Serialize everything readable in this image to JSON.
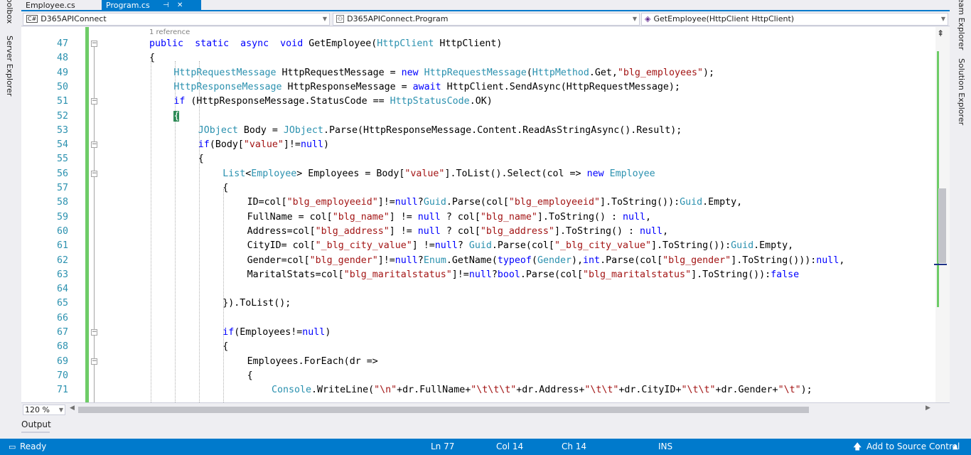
{
  "tabs": [
    {
      "label": "Employee.cs",
      "active": false
    },
    {
      "label": "Program.cs",
      "active": true
    }
  ],
  "nav": {
    "project": "D365APIConnect",
    "type": "D365APIConnect.Program",
    "member": "GetEmployee(HttpClient HttpClient)"
  },
  "left_tool_windows": [
    "Toolbox",
    "Server Explorer"
  ],
  "right_tool_windows": [
    "Team Explorer",
    "Solution Explorer"
  ],
  "codelens": "1 reference",
  "lines": [
    {
      "n": "47",
      "indent": 0,
      "tokens": [
        [
          "k",
          "public"
        ],
        [
          "",
          "  "
        ],
        [
          "k",
          "static"
        ],
        [
          "",
          "  "
        ],
        [
          "k",
          "async"
        ],
        [
          "",
          "  "
        ],
        [
          "k",
          "void"
        ],
        [
          "",
          " GetEmployee("
        ],
        [
          "t",
          "HttpClient"
        ],
        [
          "",
          " HttpClient)"
        ]
      ]
    },
    {
      "n": "48",
      "indent": 0,
      "tokens": [
        [
          "",
          "{"
        ]
      ]
    },
    {
      "n": "49",
      "indent": 1,
      "tokens": [
        [
          "t",
          "HttpRequestMessage"
        ],
        [
          "",
          " HttpRequestMessage = "
        ],
        [
          "k",
          "new"
        ],
        [
          "",
          " "
        ],
        [
          "t",
          "HttpRequestMessage"
        ],
        [
          "",
          "("
        ],
        [
          "t",
          "HttpMethod"
        ],
        [
          "",
          ".Get,"
        ],
        [
          "s",
          "\"blg_employees\""
        ],
        [
          "",
          ");"
        ]
      ]
    },
    {
      "n": "50",
      "indent": 1,
      "tokens": [
        [
          "t",
          "HttpResponseMessage"
        ],
        [
          "",
          " HttpResponseMessage = "
        ],
        [
          "k",
          "await"
        ],
        [
          "",
          " HttpClient.SendAsync(HttpRequestMessage);"
        ]
      ]
    },
    {
      "n": "51",
      "indent": 1,
      "tokens": [
        [
          "k",
          "if"
        ],
        [
          "",
          " (HttpResponseMessage.StatusCode == "
        ],
        [
          "t",
          "HttpStatusCode"
        ],
        [
          "",
          ".OK)"
        ]
      ]
    },
    {
      "n": "52",
      "indent": 1,
      "tokens": [
        [
          "brace",
          "{"
        ]
      ]
    },
    {
      "n": "53",
      "indent": 2,
      "tokens": [
        [
          "t",
          "JObject"
        ],
        [
          "",
          " Body = "
        ],
        [
          "t",
          "JObject"
        ],
        [
          "",
          ".Parse(HttpResponseMessage.Content.ReadAsStringAsync().Result);"
        ]
      ]
    },
    {
      "n": "54",
      "indent": 2,
      "tokens": [
        [
          "k",
          "if"
        ],
        [
          "",
          "(Body["
        ],
        [
          "s",
          "\"value\""
        ],
        [
          "",
          "]!="
        ],
        [
          "k",
          "null"
        ],
        [
          "",
          ")"
        ]
      ]
    },
    {
      "n": "55",
      "indent": 2,
      "tokens": [
        [
          "",
          "{"
        ]
      ]
    },
    {
      "n": "56",
      "indent": 3,
      "tokens": [
        [
          "t",
          "List"
        ],
        [
          "",
          "<"
        ],
        [
          "t",
          "Employee"
        ],
        [
          "",
          "> Employees = Body["
        ],
        [
          "s",
          "\"value\""
        ],
        [
          "",
          "].ToList().Select(col => "
        ],
        [
          "k",
          "new"
        ],
        [
          "",
          " "
        ],
        [
          "t",
          "Employee"
        ]
      ]
    },
    {
      "n": "57",
      "indent": 3,
      "tokens": [
        [
          "",
          "{"
        ]
      ]
    },
    {
      "n": "58",
      "indent": 4,
      "tokens": [
        [
          "",
          "ID=col["
        ],
        [
          "s",
          "\"blg_employeeid\""
        ],
        [
          "",
          "]!="
        ],
        [
          "k",
          "null"
        ],
        [
          "",
          "?"
        ],
        [
          "t",
          "Guid"
        ],
        [
          "",
          ".Parse(col["
        ],
        [
          "s",
          "\"blg_employeeid\""
        ],
        [
          "",
          "].ToString()):"
        ],
        [
          "t",
          "Guid"
        ],
        [
          "",
          ".Empty,"
        ]
      ]
    },
    {
      "n": "59",
      "indent": 4,
      "tokens": [
        [
          "",
          "FullName = col["
        ],
        [
          "s",
          "\"blg_name\""
        ],
        [
          "",
          "] != "
        ],
        [
          "k",
          "null"
        ],
        [
          "",
          " ? col["
        ],
        [
          "s",
          "\"blg_name\""
        ],
        [
          "",
          "].ToString() : "
        ],
        [
          "k",
          "null"
        ],
        [
          "",
          ","
        ]
      ]
    },
    {
      "n": "60",
      "indent": 4,
      "tokens": [
        [
          "",
          "Address=col["
        ],
        [
          "s",
          "\"blg_address\""
        ],
        [
          "",
          "] != "
        ],
        [
          "k",
          "null"
        ],
        [
          "",
          " ? col["
        ],
        [
          "s",
          "\"blg_address\""
        ],
        [
          "",
          "].ToString() : "
        ],
        [
          "k",
          "null"
        ],
        [
          "",
          ","
        ]
      ]
    },
    {
      "n": "61",
      "indent": 4,
      "tokens": [
        [
          "",
          "CityID= col["
        ],
        [
          "s",
          "\"_blg_city_value\""
        ],
        [
          "",
          "] !="
        ],
        [
          "k",
          "null"
        ],
        [
          "",
          "? "
        ],
        [
          "t",
          "Guid"
        ],
        [
          "",
          ".Parse(col["
        ],
        [
          "s",
          "\"_blg_city_value\""
        ],
        [
          "",
          "].ToString()):"
        ],
        [
          "t",
          "Guid"
        ],
        [
          "",
          ".Empty,"
        ]
      ]
    },
    {
      "n": "62",
      "indent": 4,
      "tokens": [
        [
          "",
          "Gender=col["
        ],
        [
          "s",
          "\"blg_gender\""
        ],
        [
          "",
          "]!="
        ],
        [
          "k",
          "null"
        ],
        [
          "",
          "?"
        ],
        [
          "t",
          "Enum"
        ],
        [
          "",
          ".GetName("
        ],
        [
          "k",
          "typeof"
        ],
        [
          "",
          "("
        ],
        [
          "t",
          "Gender"
        ],
        [
          "",
          "),"
        ],
        [
          "k",
          "int"
        ],
        [
          "",
          ".Parse(col["
        ],
        [
          "s",
          "\"blg_gender\""
        ],
        [
          "",
          "].ToString())):"
        ],
        [
          "k",
          "null"
        ],
        [
          "",
          ","
        ]
      ]
    },
    {
      "n": "63",
      "indent": 4,
      "tokens": [
        [
          "",
          "MaritalStats=col["
        ],
        [
          "s",
          "\"blg_maritalstatus\""
        ],
        [
          "",
          "]!="
        ],
        [
          "k",
          "null"
        ],
        [
          "",
          "?"
        ],
        [
          "k",
          "bool"
        ],
        [
          "",
          ".Parse(col["
        ],
        [
          "s",
          "\"blg_maritalstatus\""
        ],
        [
          "",
          "].ToString()):"
        ],
        [
          "k",
          "false"
        ]
      ]
    },
    {
      "n": "64",
      "indent": 4,
      "tokens": []
    },
    {
      "n": "65",
      "indent": 3,
      "tokens": [
        [
          "",
          "}).ToList();"
        ]
      ]
    },
    {
      "n": "66",
      "indent": 3,
      "tokens": []
    },
    {
      "n": "67",
      "indent": 3,
      "tokens": [
        [
          "k",
          "if"
        ],
        [
          "",
          "(Employees!="
        ],
        [
          "k",
          "null"
        ],
        [
          "",
          ")"
        ]
      ]
    },
    {
      "n": "68",
      "indent": 3,
      "tokens": [
        [
          "",
          "{"
        ]
      ]
    },
    {
      "n": "69",
      "indent": 4,
      "tokens": [
        [
          "",
          "Employees.ForEach(dr =>"
        ]
      ]
    },
    {
      "n": "70",
      "indent": 4,
      "tokens": [
        [
          "",
          "{"
        ]
      ]
    },
    {
      "n": "71",
      "indent": 5,
      "tokens": [
        [
          "t",
          "Console"
        ],
        [
          "",
          ".WriteLine("
        ],
        [
          "s",
          "\"\\n\""
        ],
        [
          "",
          "+dr.FullName+"
        ],
        [
          "s",
          "\"\\t\\t\\t\""
        ],
        [
          "",
          "+dr.Address+"
        ],
        [
          "s",
          "\"\\t\\t\""
        ],
        [
          "",
          "+dr.CityID+"
        ],
        [
          "s",
          "\"\\t\\t\""
        ],
        [
          "",
          "+dr.Gender+"
        ],
        [
          "s",
          "\"\\t\""
        ],
        [
          "",
          ");"
        ]
      ]
    }
  ],
  "zoom": "120 %",
  "output_tab": "Output",
  "status": {
    "ready": "Ready",
    "ln": "Ln 77",
    "col": "Col 14",
    "ch": "Ch 14",
    "mode": "INS",
    "source_control": "Add to Source Control"
  },
  "colors": {
    "accent": "#007acc",
    "keyword": "#0000ff",
    "type": "#2b91af",
    "string": "#a31515",
    "change_bar": "#6ecc67"
  }
}
